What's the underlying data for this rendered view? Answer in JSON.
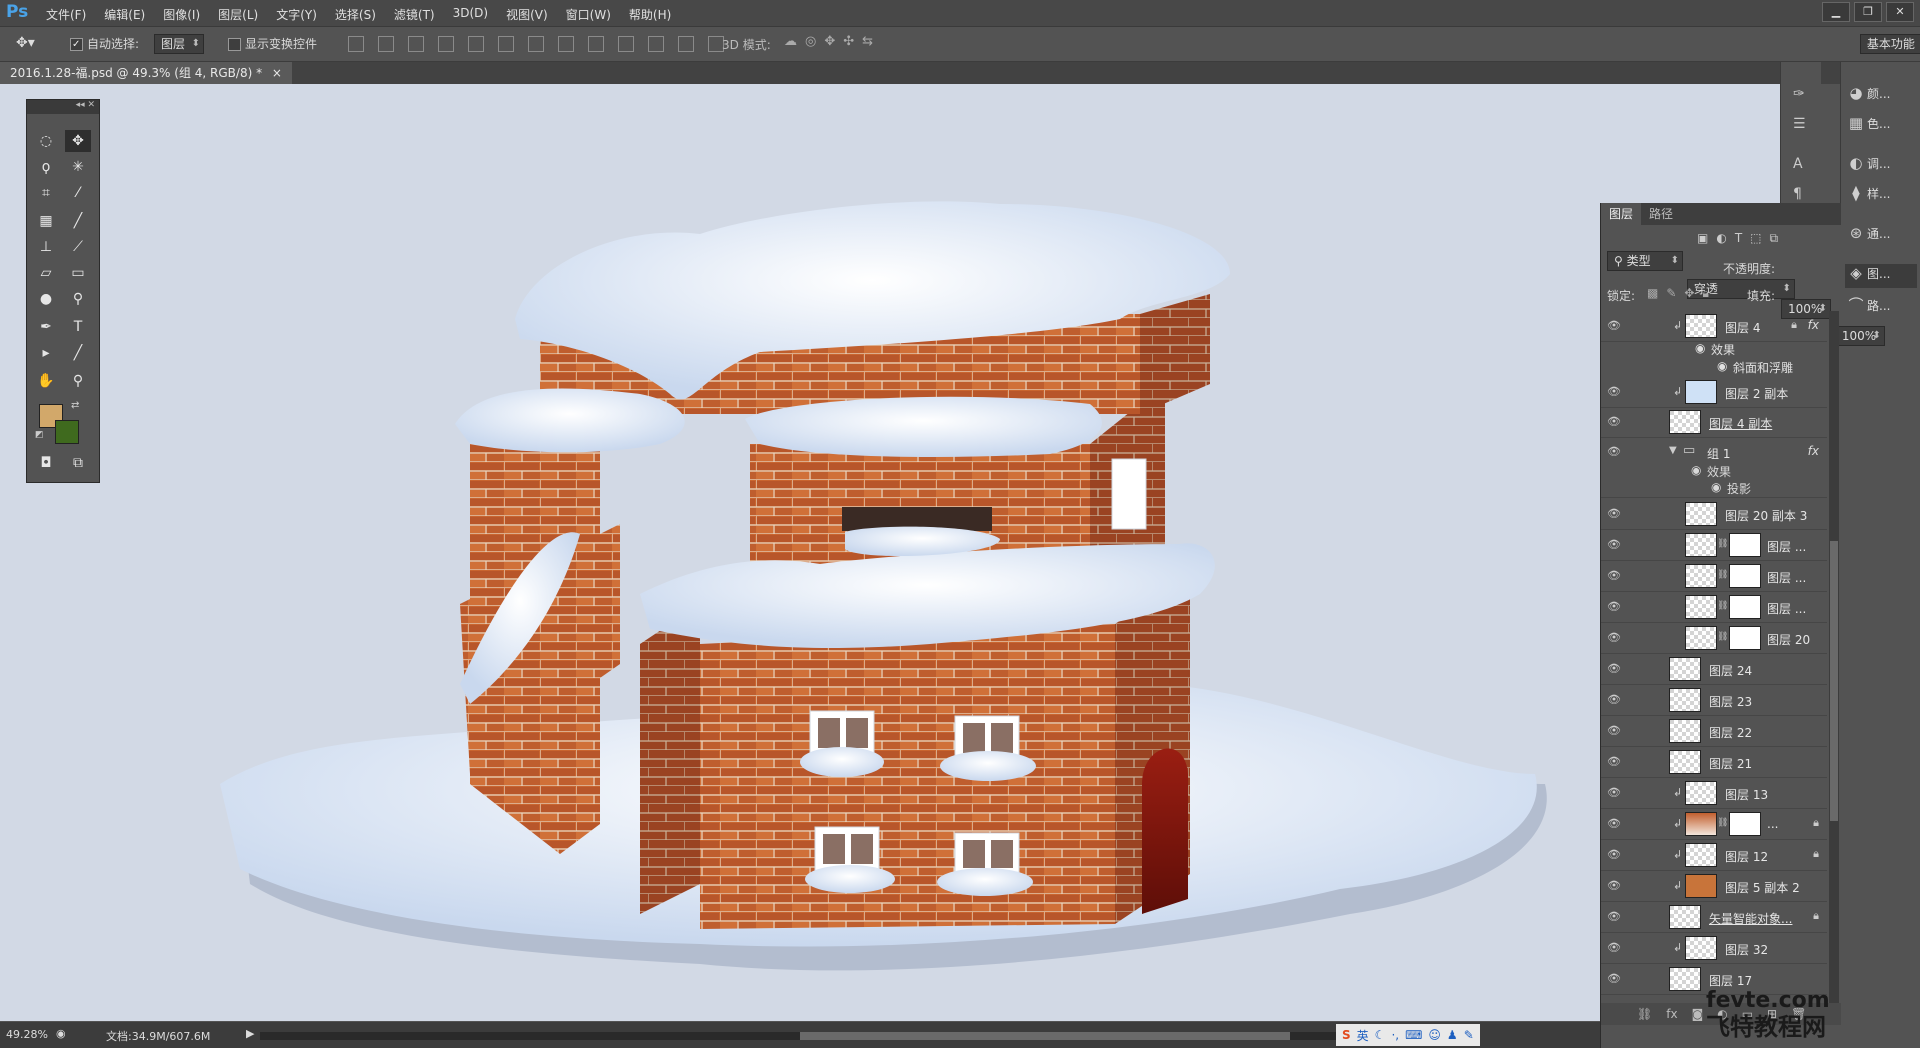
{
  "app": {
    "logo": "Ps"
  },
  "menu": [
    "文件(F)",
    "编辑(E)",
    "图像(I)",
    "图层(L)",
    "文字(Y)",
    "选择(S)",
    "滤镜(T)",
    "3D(D)",
    "视图(V)",
    "窗口(W)",
    "帮助(H)"
  ],
  "options": {
    "auto_select_label": "自动选择:",
    "auto_select_value": "图层",
    "show_transform_label": "显示变换控件",
    "mode_3d_label": "3D 模式:",
    "workspace": "基本功能"
  },
  "document": {
    "tab_title": "2016.1.28-福.psd @ 49.3% (组 4, RGB/8) *"
  },
  "status": {
    "zoom": "49.28%",
    "doc_info": "文档:34.9M/607.6M"
  },
  "ime": {
    "label": "英"
  },
  "layers_panel": {
    "tabs": [
      "图层",
      "路径"
    ],
    "filter_type": "类型",
    "blend_mode": "穿透",
    "opacity_label": "不透明度:",
    "opacity_value": "100%",
    "lock_label": "锁定:",
    "fill_label": "填充:",
    "fill_value": "100%",
    "rows": [
      {
        "name": "图层 4",
        "fx": true,
        "clip": true,
        "lock": true
      },
      {
        "name": "效果",
        "type": "effect"
      },
      {
        "name": "斜面和浮雕",
        "type": "effect-item"
      },
      {
        "name": "图层 2 副本",
        "clip": true
      },
      {
        "name": "图层 4 副本"
      },
      {
        "name": "组 1",
        "type": "group",
        "fx": true
      },
      {
        "name": "效果",
        "type": "effect"
      },
      {
        "name": "投影",
        "type": "effect-item"
      },
      {
        "name": "图层 20 副本 3"
      },
      {
        "name": "图层 ...",
        "mask": true
      },
      {
        "name": "图层 ...",
        "mask": true
      },
      {
        "name": "图层 ...",
        "mask": true
      },
      {
        "name": "图层 20",
        "mask": true
      },
      {
        "name": "图层 24"
      },
      {
        "name": "图层 23"
      },
      {
        "name": "图层 22"
      },
      {
        "name": "图层 21"
      },
      {
        "name": "图层 13",
        "clip": true
      },
      {
        "name": "...",
        "clip": true,
        "mask": true,
        "lock": true
      },
      {
        "name": "图层 12",
        "clip": true,
        "lock": true
      },
      {
        "name": "图层 5 副本 2",
        "clip": true
      },
      {
        "name": "矢量智能对象...",
        "lock": true
      },
      {
        "name": "图层 32",
        "clip": true
      },
      {
        "name": "图层 17"
      }
    ]
  },
  "right_dock": {
    "col2": [
      "颜...",
      "色...",
      "调...",
      "样...",
      "通...",
      "图...",
      "路..."
    ]
  },
  "watermark": {
    "line1": "fevte.com",
    "line2": "飞特教程网"
  }
}
